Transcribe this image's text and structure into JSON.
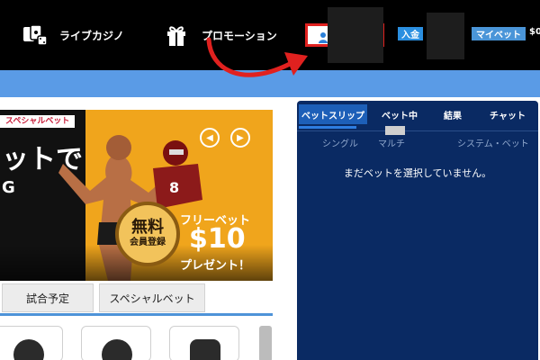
{
  "header": {
    "nav": [
      {
        "label": "ライブカジノ",
        "icon": "live-casino-icon"
      },
      {
        "label": "プロモーション",
        "icon": "gift-icon"
      }
    ],
    "user_icon": "user-icon",
    "deposit_label": "入金",
    "mybet_label": "マイベット",
    "balance_text": "$0"
  },
  "banner": {
    "tag": "スペシャルベット",
    "headline": "ットで",
    "subline": "G",
    "badge_line1": "無料",
    "badge_line2": "会員登録",
    "free_label": "フリーベット",
    "amount": "$10",
    "present_label": "プレゼント！",
    "prev_icon": "chevron-left-icon",
    "next_icon": "chevron-right-icon"
  },
  "tabs": [
    {
      "label": "試合予定"
    },
    {
      "label": "スペシャルベット"
    }
  ],
  "betslip": {
    "tabs": [
      {
        "label": "ベットスリップ",
        "active": true
      },
      {
        "label": "ベット中",
        "active": false
      },
      {
        "label": "結果",
        "active": false
      },
      {
        "label": "チャット",
        "active": false
      }
    ],
    "subtabs": [
      {
        "label": "シングル"
      },
      {
        "label": "マルチ"
      },
      {
        "label": "システム・ベット"
      }
    ],
    "empty_message": "まだベットを選択していません。"
  },
  "colors": {
    "header_bg": "#000000",
    "subbar_bg": "#5a9be6",
    "slip_bg": "#0a2a63",
    "annotation_red": "#e0211f",
    "banner_orange": "#f0a51c"
  }
}
